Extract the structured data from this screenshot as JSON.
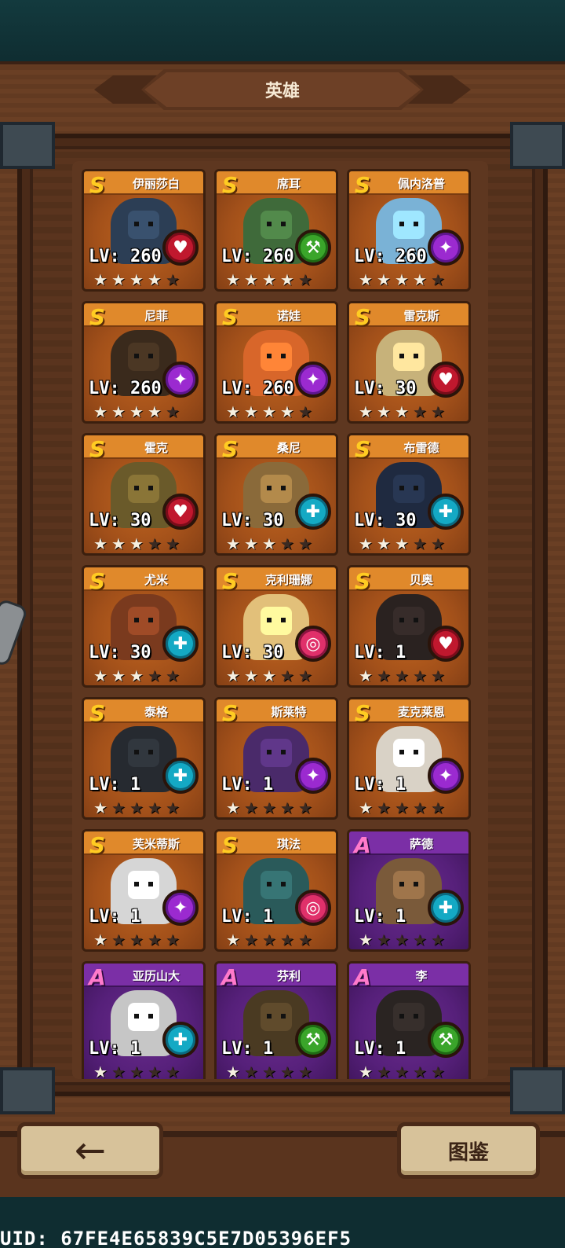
{
  "header": {
    "title": "英雄"
  },
  "footer": {
    "back_label": "←",
    "codex_label": "图鉴",
    "uid_text": "UID: 67FE4E65839C5E7D05396EF5"
  },
  "class_colors": {
    "red": "#c0182e",
    "green": "#3aa52a",
    "purple": "#9b2ad0",
    "cyan": "#14a9c4",
    "pink": "#e0306a"
  },
  "heroes": [
    {
      "name": "伊丽莎白",
      "rarity": "S",
      "level": "LV: 260",
      "stars": 4,
      "class": "red",
      "class_icon": "heart-icon",
      "portrait": "#2c3e55"
    },
    {
      "name": "席耳",
      "rarity": "S",
      "level": "LV: 260",
      "stars": 4,
      "class": "green",
      "class_icon": "leaf-icon",
      "portrait": "#3f6a3a"
    },
    {
      "name": "佩内洛普",
      "rarity": "S",
      "level": "LV: 260",
      "stars": 4,
      "class": "purple",
      "class_icon": "staff-icon",
      "portrait": "#7ab2d6"
    },
    {
      "name": "尼菲",
      "rarity": "S",
      "level": "LV: 260",
      "stars": 4,
      "class": "purple",
      "class_icon": "staff-icon",
      "portrait": "#3a2a1c"
    },
    {
      "name": "诺娃",
      "rarity": "S",
      "level": "LV: 260",
      "stars": 4,
      "class": "purple",
      "class_icon": "staff-icon",
      "portrait": "#d8662a"
    },
    {
      "name": "雷克斯",
      "rarity": "S",
      "level": "LV: 30",
      "stars": 3,
      "class": "red",
      "class_icon": "heart-icon",
      "portrait": "#c7b27a"
    },
    {
      "name": "霍克",
      "rarity": "S",
      "level": "LV: 30",
      "stars": 3,
      "class": "red",
      "class_icon": "heart-icon",
      "portrait": "#6a5a2a"
    },
    {
      "name": "桑尼",
      "rarity": "S",
      "level": "LV: 30",
      "stars": 3,
      "class": "cyan",
      "class_icon": "orb-icon",
      "portrait": "#8a6a3a"
    },
    {
      "name": "布雷德",
      "rarity": "S",
      "level": "LV: 30",
      "stars": 3,
      "class": "cyan",
      "class_icon": "orb-icon",
      "portrait": "#1f2a40"
    },
    {
      "name": "尤米",
      "rarity": "S",
      "level": "LV: 30",
      "stars": 3,
      "class": "cyan",
      "class_icon": "orb-icon",
      "portrait": "#7a3a1e"
    },
    {
      "name": "克利珊娜",
      "rarity": "S",
      "level": "LV: 30",
      "stars": 3,
      "class": "pink",
      "class_icon": "target-icon",
      "portrait": "#e2c07a"
    },
    {
      "name": "贝奥",
      "rarity": "S",
      "level": "LV: 1",
      "stars": 1,
      "class": "red",
      "class_icon": "heart-icon",
      "portrait": "#2a2220"
    },
    {
      "name": "泰格",
      "rarity": "S",
      "level": "LV: 1",
      "stars": 1,
      "class": "cyan",
      "class_icon": "orb-icon",
      "portrait": "#262a30"
    },
    {
      "name": "斯莱特",
      "rarity": "S",
      "level": "LV: 1",
      "stars": 1,
      "class": "purple",
      "class_icon": "staff-icon",
      "portrait": "#4a2a6a"
    },
    {
      "name": "麦克莱恩",
      "rarity": "S",
      "level": "LV: 1",
      "stars": 1,
      "class": "purple",
      "class_icon": "staff-icon",
      "portrait": "#d9d2c6"
    },
    {
      "name": "芙米蒂斯",
      "rarity": "S",
      "level": "LV: 1",
      "stars": 1,
      "class": "purple",
      "class_icon": "staff-icon",
      "portrait": "#d6d6d6"
    },
    {
      "name": "琪法",
      "rarity": "S",
      "level": "LV: 1",
      "stars": 1,
      "class": "pink",
      "class_icon": "target-icon",
      "portrait": "#2a5a5a"
    },
    {
      "name": "萨德",
      "rarity": "A",
      "level": "LV: 1",
      "stars": 1,
      "class": "cyan",
      "class_icon": "orb-icon",
      "portrait": "#7a5a3a"
    },
    {
      "name": "亚历山大",
      "rarity": "A",
      "level": "LV: 1",
      "stars": 1,
      "class": "cyan",
      "class_icon": "orb-icon",
      "portrait": "#c6c6c6"
    },
    {
      "name": "芬利",
      "rarity": "A",
      "level": "LV: 1",
      "stars": 1,
      "class": "green",
      "class_icon": "leaf-icon",
      "portrait": "#4a3a22"
    },
    {
      "name": "李",
      "rarity": "A",
      "level": "LV: 1",
      "stars": 1,
      "class": "green",
      "class_icon": "leaf-icon",
      "portrait": "#2a2422"
    }
  ]
}
